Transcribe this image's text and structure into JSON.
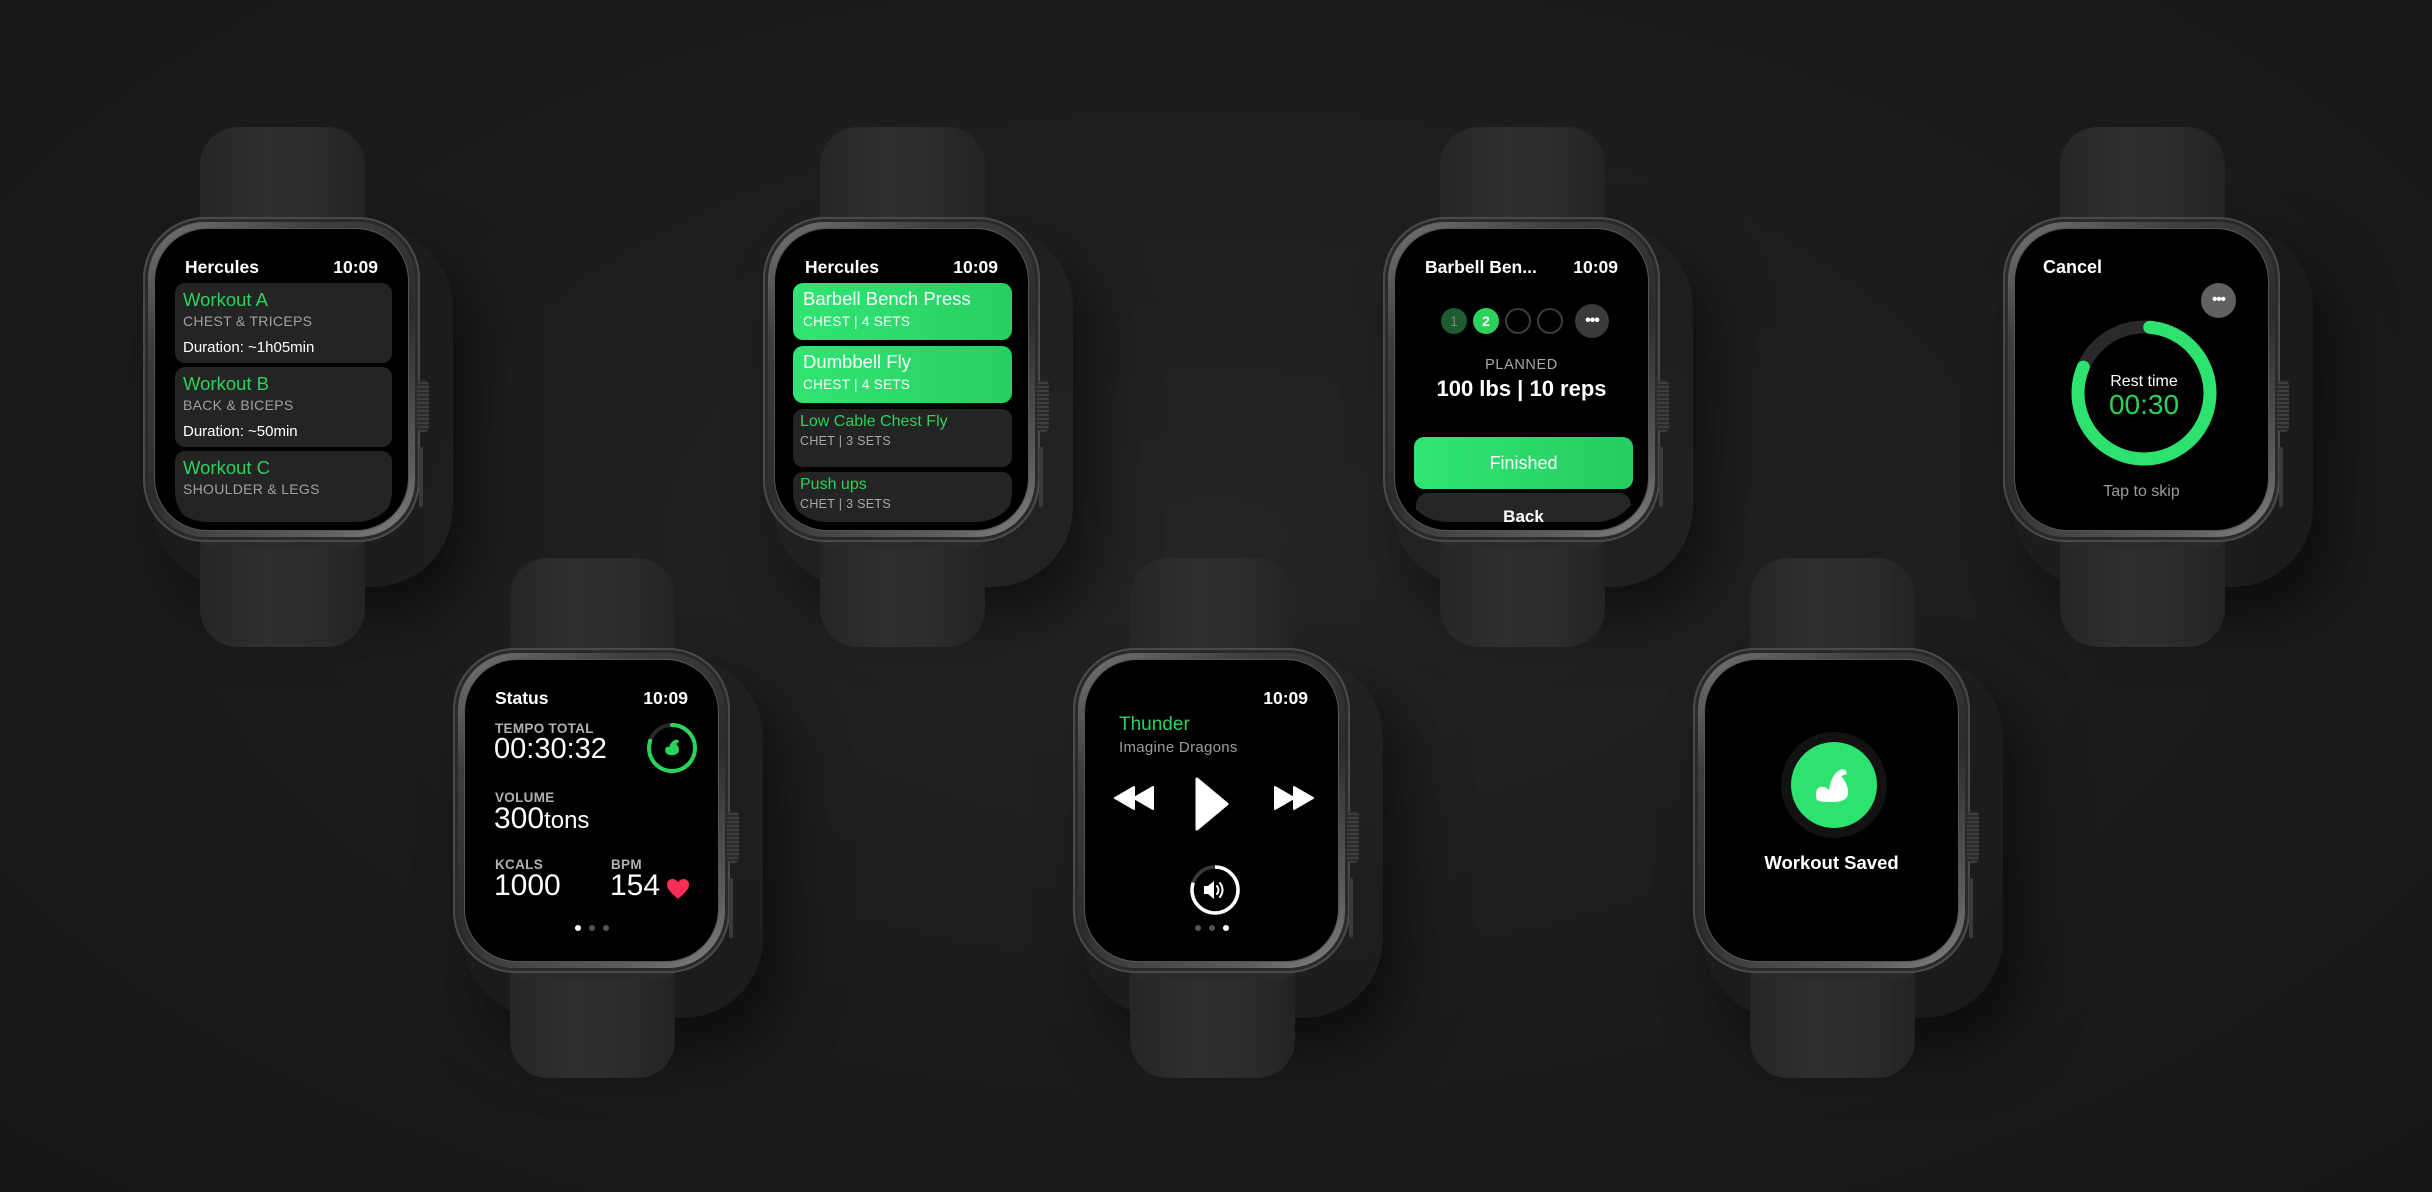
{
  "colors": {
    "accent": "#2bd25c",
    "accent_bright": "#31e573",
    "card_bg": "#242424",
    "heart": "#ff2d55",
    "background": "#1c1c1c"
  },
  "clock": "10:09",
  "watches": {
    "workouts": {
      "title": "Hercules",
      "time": "10:09",
      "items": [
        {
          "name": "Workout A",
          "muscles": "CHEST & TRICEPS",
          "duration": "Duration: ~1h05min"
        },
        {
          "name": "Workout B",
          "muscles": "BACK & BICEPS",
          "duration": "Duration: ~50min"
        },
        {
          "name": "Workout C",
          "muscles": "SHOULDER & LEGS",
          "duration": ""
        }
      ]
    },
    "exercises": {
      "title": "Hercules",
      "time": "10:09",
      "items": [
        {
          "name": "Barbell Bench Press",
          "detail": "CHEST | 4 SETS",
          "state": "active"
        },
        {
          "name": "Dumbbell Fly",
          "detail": "CHEST | 4 SETS",
          "state": "active"
        },
        {
          "name": "Low Cable Chest Fly",
          "detail": "CHET | 3 SETS",
          "state": "idle"
        },
        {
          "name": "Push ups",
          "detail": "CHET | 3 SETS",
          "state": "idle"
        }
      ]
    },
    "set": {
      "title": "Barbell Ben...",
      "time": "10:09",
      "sets": [
        {
          "label": "1",
          "state": "done"
        },
        {
          "label": "2",
          "state": "current"
        },
        {
          "label": "",
          "state": "todo"
        },
        {
          "label": "",
          "state": "todo"
        }
      ],
      "more_icon": "ellipsis-icon",
      "planned_label": "PLANNED",
      "planned_value": "100 lbs | 10 reps",
      "finish_label": "Finished",
      "back_label": "Back"
    },
    "rest": {
      "cancel_label": "Cancel",
      "more_icon": "ellipsis-icon",
      "label": "Rest time",
      "value": "00:30",
      "progress": 0.8,
      "skip_label": "Tap to skip"
    },
    "status": {
      "title": "Status",
      "time": "10:09",
      "tempo_label": "TEMPO TOTAL",
      "tempo_value": "00:30:32",
      "ring_progress": 0.8,
      "ring_icon": "flexed-bicep-icon",
      "volume_label": "VOLUME",
      "volume_value": "300",
      "volume_unit": "tons",
      "kcals_label": "KCALS",
      "kcals_value": "1000",
      "bpm_label": "BPM",
      "bpm_value": "154",
      "bpm_icon": "heart-icon",
      "page_index": 0,
      "page_count": 3
    },
    "music": {
      "time": "10:09",
      "song": "Thunder",
      "artist": "Imagine Dragons",
      "controls": [
        "rewind-icon",
        "play-icon",
        "fast-forward-icon"
      ],
      "volume_icon": "speaker-icon",
      "volume_level": 0.8,
      "page_index": 2,
      "page_count": 3
    },
    "saved": {
      "icon": "flexed-bicep-icon",
      "label": "Workout Saved"
    }
  }
}
